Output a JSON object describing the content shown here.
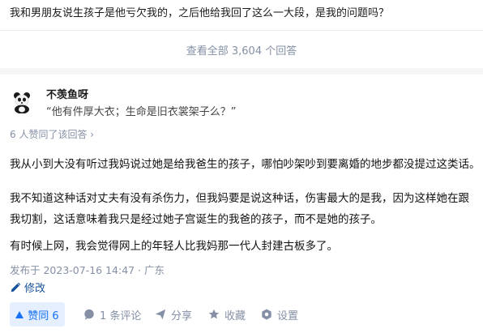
{
  "question": {
    "title": "我和男朋友说生孩子是他亏欠我的，之后他给我回了这么一大段，是我的问题吗？",
    "view_all": "查看全部 3,604 个回答"
  },
  "answer": {
    "author_name": "不羡鱼呀",
    "author_bio": "“他有件厚大衣；生命是旧衣裳架子么？”",
    "voters": "6 人赞同了该回答 ›",
    "paragraphs": [
      "我从小到大没有听过我妈说过她是给我爸生的孩子，哪怕吵架吵到要离婚的地步都没提过这类话。",
      "我不知道这种话对丈夫有没有杀伤力，但我妈要是说这种话，伤害最大的是我，因为这样她在跟我切割，这话意味着我只是经过她子宫诞生的我爸的孩子，而不是她的孩子。",
      "有时候上网，我会觉得网上的年轻人比我妈那一代人封建古板多了。"
    ],
    "meta": "发布于 2023-07-16 14:47 · 广东",
    "edit_label": "修改"
  },
  "actions": {
    "vote_label": "赞同 6",
    "comment_label": "1 条评论",
    "share_label": "分享",
    "favorite_label": "收藏",
    "settings_label": "设置"
  },
  "colors": {
    "accent": "#1772f6",
    "accent_bg": "#e5efff",
    "muted": "#8590a6",
    "link": "#175199"
  }
}
